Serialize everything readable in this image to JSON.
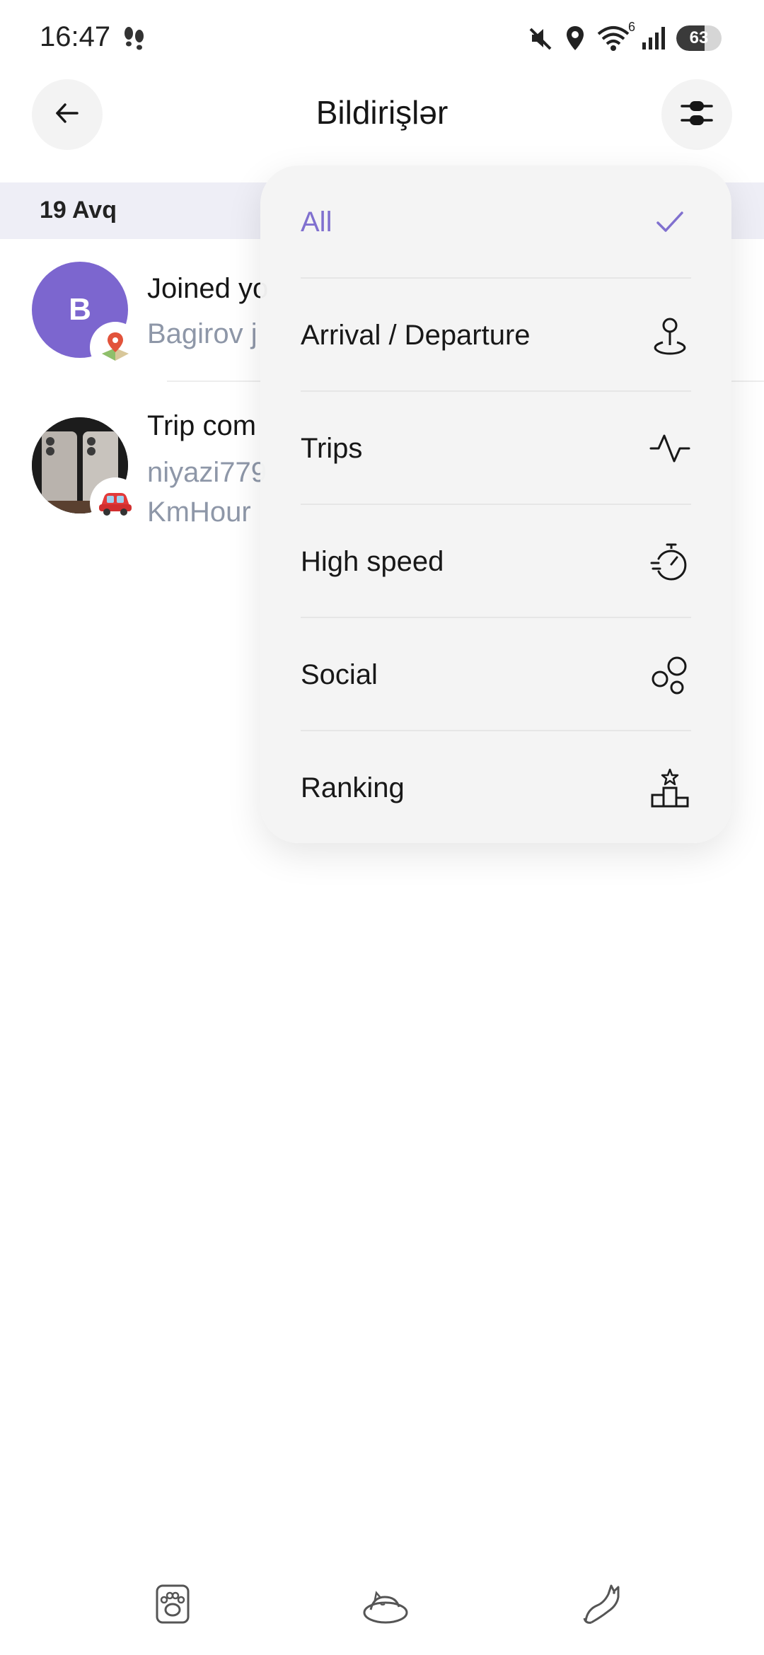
{
  "status_bar": {
    "time": "16:47",
    "battery_level": "63",
    "battery_fraction": 0.63,
    "network_badge": "6",
    "icons": [
      "steps-icon",
      "mute-icon",
      "location-icon",
      "wifi-icon",
      "signal-icon",
      "battery-icon"
    ]
  },
  "header": {
    "title": "Bildirişlər",
    "back_icon": "arrow-left-icon",
    "filter_icon": "filter-sliders-icon"
  },
  "date_group": {
    "label": "19 Avq"
  },
  "notifications": [
    {
      "avatar_letter": "B",
      "avatar_color": "#7c66cf",
      "badge_icon": "map-pin-icon",
      "title": "Joined yo",
      "subtitle": "Bagirov j"
    },
    {
      "avatar_kind": "photo",
      "badge_icon": "red-car-icon",
      "title": "Trip com",
      "subtitle_line1": "niyazi779",
      "subtitle_line2": "KmHour"
    }
  ],
  "filter_menu": {
    "items": [
      {
        "label": "All",
        "icon": "check-icon",
        "selected": true
      },
      {
        "label": "Arrival / Departure",
        "icon": "location-pin-icon",
        "selected": false
      },
      {
        "label": "Trips",
        "icon": "pulse-icon",
        "selected": false
      },
      {
        "label": "High speed",
        "icon": "stopwatch-icon",
        "selected": false
      },
      {
        "label": "Social",
        "icon": "bubbles-icon",
        "selected": false
      },
      {
        "label": "Ranking",
        "icon": "podium-icon",
        "selected": false
      }
    ],
    "accent_color": "#8070cf"
  },
  "bottom_nav": {
    "items": [
      {
        "icon": "paw-icon"
      },
      {
        "icon": "sleeping-cat-icon"
      },
      {
        "icon": "jumping-cat-icon"
      }
    ]
  }
}
